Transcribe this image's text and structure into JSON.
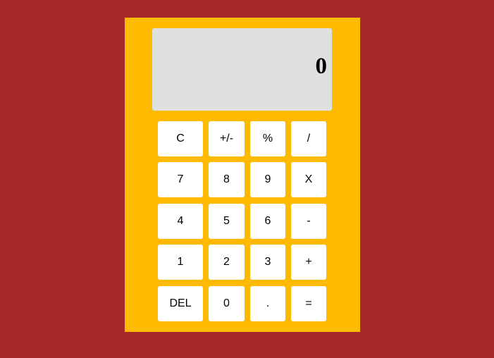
{
  "colors": {
    "page_background": "#a6292b",
    "calculator_body": "#fdba00",
    "display_background": "#e0e0e0",
    "key_background": "#ffffff"
  },
  "display": {
    "value": "0"
  },
  "keys": {
    "clear": "C",
    "sign": "+/-",
    "percent": "%",
    "divide": "/",
    "seven": "7",
    "eight": "8",
    "nine": "9",
    "multiply": "X",
    "four": "4",
    "five": "5",
    "six": "6",
    "subtract": "-",
    "one": "1",
    "two": "2",
    "three": "3",
    "add": "+",
    "delete": "DEL",
    "zero": "0",
    "decimal": ".",
    "equals": "="
  }
}
